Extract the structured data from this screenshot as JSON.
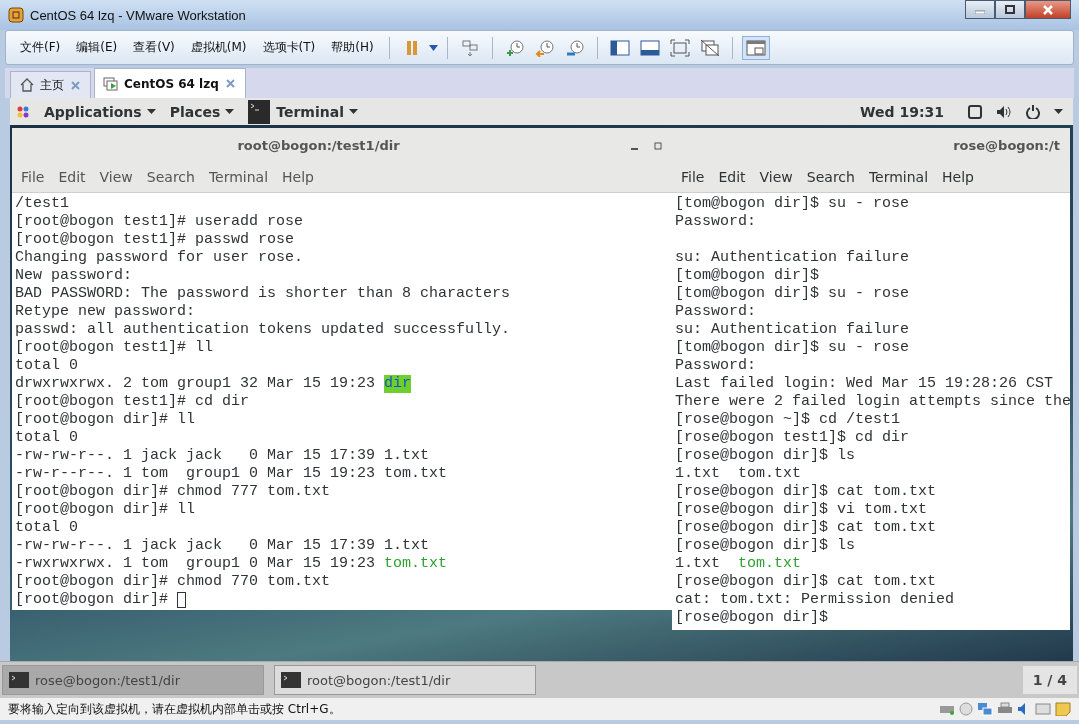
{
  "window": {
    "title": "CentOS 64 lzq - VMware Workstation"
  },
  "menu": [
    "文件(F)",
    "编辑(E)",
    "查看(V)",
    "虚拟机(M)",
    "选项卡(T)",
    "帮助(H)"
  ],
  "tabs": [
    {
      "label": "主页",
      "selected": false,
      "kind": "home"
    },
    {
      "label": "CentOS 64 lzq",
      "selected": true,
      "kind": "vm"
    }
  ],
  "gnome_bar": {
    "menus": [
      "Applications",
      "Places"
    ],
    "active_app": "Terminal",
    "clock": "Wed 19:31"
  },
  "terminals": [
    {
      "title": "root@bogon:/test1/dir",
      "menu": [
        "File",
        "Edit",
        "View",
        "Search",
        "Terminal",
        "Help"
      ],
      "cursor": true,
      "lines": [
        "/test1",
        "[root@bogon test1]# useradd rose",
        "[root@bogon test1]# passwd rose",
        "Changing password for user rose.",
        "New password:",
        "BAD PASSWORD: The password is shorter than 8 characters",
        "Retype new password:",
        "passwd: all authentication tokens updated successfully.",
        "[root@bogon test1]# ll",
        "total 0",
        [
          {
            "text": "drwxrwxrwx. 2 tom group1 32 Mar 15 19:23 ",
            "kind": "plain"
          },
          {
            "text": "dir",
            "kind": "directory"
          }
        ],
        "[root@bogon test1]# cd dir",
        "[root@bogon dir]# ll",
        "total 0",
        "-rw-rw-r--. 1 jack jack   0 Mar 15 17:39 1.txt",
        "-rw-r--r--. 1 tom  group1 0 Mar 15 19:23 tom.txt",
        "[root@bogon dir]# chmod 777 tom.txt",
        "[root@bogon dir]# ll",
        "total 0",
        "-rw-rw-r--. 1 jack jack   0 Mar 15 17:39 1.txt",
        [
          {
            "text": "-rwxrwxrwx. 1 tom  group1 0 Mar 15 19:23 ",
            "kind": "plain"
          },
          {
            "text": "tom.txt",
            "kind": "executable"
          }
        ],
        "[root@bogon dir]# chmod 770 tom.txt",
        "[root@bogon dir]# "
      ]
    },
    {
      "title": "rose@bogon:/t",
      "menu": [
        "File",
        "Edit",
        "View",
        "Search",
        "Terminal",
        "Help"
      ],
      "cursor": false,
      "lines": [
        "[tom@bogon dir]$ su - rose",
        "Password:",
        {
          "kind": "blank"
        },
        "su: Authentication failure",
        "[tom@bogon dir]$",
        "[tom@bogon dir]$ su - rose",
        "Password:",
        "su: Authentication failure",
        "[tom@bogon dir]$ su - rose",
        "Password:",
        "Last failed login: Wed Mar 15 19:28:26 CST",
        "There were 2 failed login attempts since the",
        "[rose@bogon ~]$ cd /test1",
        "[rose@bogon test1]$ cd dir",
        "[rose@bogon dir]$ ls",
        "1.txt  tom.txt",
        "[rose@bogon dir]$ cat tom.txt",
        "[rose@bogon dir]$ vi tom.txt",
        "[rose@bogon dir]$ cat tom.txt",
        "[rose@bogon dir]$ ls",
        [
          {
            "text": "1.txt  ",
            "kind": "plain"
          },
          {
            "text": "tom.txt",
            "kind": "executable"
          }
        ],
        "[rose@bogon dir]$ cat tom.txt",
        "cat: tom.txt: Permission denied",
        "[rose@bogon dir]$"
      ]
    }
  ],
  "taskbar": {
    "items": [
      {
        "label": "rose@bogon:/test1/dir",
        "selected": true
      },
      {
        "label": "root@bogon:/test1/dir",
        "selected": false
      }
    ],
    "workspace": "1 / 4"
  },
  "status_bar": {
    "text": "要将输入定向到该虚拟机，请在虚拟机内部单击或按 Ctrl+G。"
  }
}
